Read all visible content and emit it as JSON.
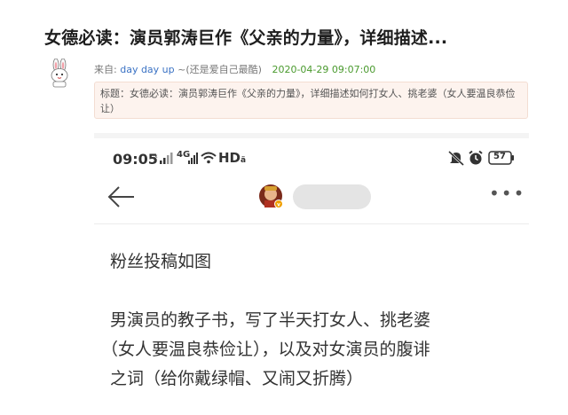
{
  "post": {
    "title": "女德必读：演员郭涛巨作《父亲的力量》，详细描述...",
    "meta_prefix": "来自:",
    "author": "day day up",
    "author_note": "~(还是爱自己最酷)",
    "date": "2020-04-29 09:07:00",
    "subject": "标题：女德必读：演员郭涛巨作《父亲的力量》，详细描述如何打女人、挑老婆（女人要温良恭俭让）"
  },
  "phone": {
    "time": "09:05",
    "network_label": "HD",
    "network_badge": "ä",
    "signal_label_1": "4G",
    "battery": "57",
    "more_label": "•••",
    "messages": [
      "粉丝投稿如图",
      "男演员的教子书，写了半天打女人、挑老婆",
      "（女人要温良恭俭让），以及对女演员的腹诽",
      "之词（给你戴绿帽、又闹又折腾）"
    ]
  },
  "colors": {
    "author_link": "#3a72c4",
    "date_green": "#4a9a2e",
    "subject_bg": "#fdf3ee"
  }
}
